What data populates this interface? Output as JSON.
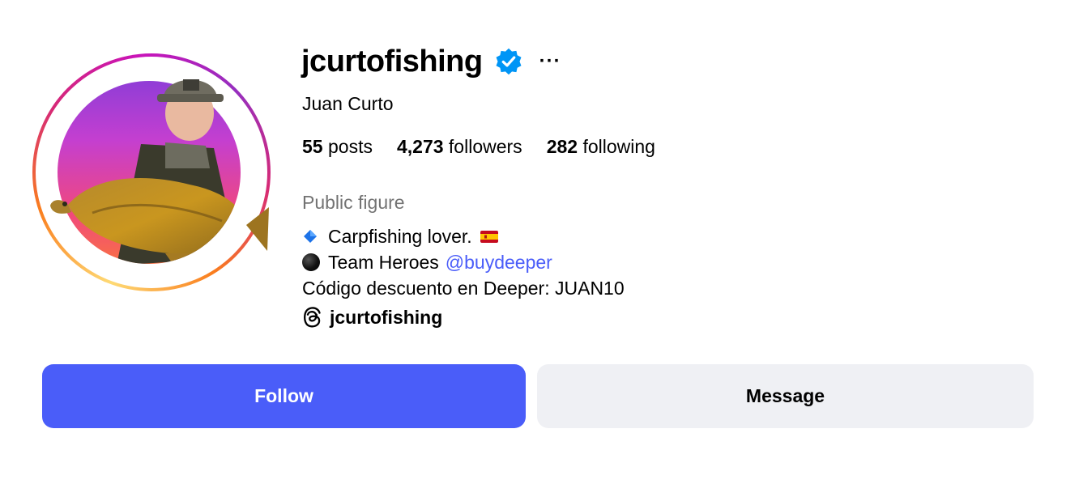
{
  "profile": {
    "username": "jcurtofishing",
    "verified": true,
    "more_icon": "more-horizontal-icon",
    "full_name": "Juan Curto",
    "stats": {
      "posts_count": "55",
      "posts_label": "posts",
      "followers_count": "4,273",
      "followers_label": "followers",
      "following_count": "282",
      "following_label": "following"
    },
    "category": "Public figure",
    "bio": {
      "line1_text": "Carpfishing lover.",
      "line2_text": "Team Heroes",
      "line2_mention": "@buydeeper",
      "line3_text": "Código descuento en Deeper: JUAN10"
    },
    "threads_handle": "jcurtofishing"
  },
  "actions": {
    "follow_label": "Follow",
    "message_label": "Message"
  },
  "colors": {
    "accent": "#4a5df9",
    "secondary_button": "#eff0f4",
    "muted_text": "#737373",
    "verified_badge": "#0095f6"
  }
}
